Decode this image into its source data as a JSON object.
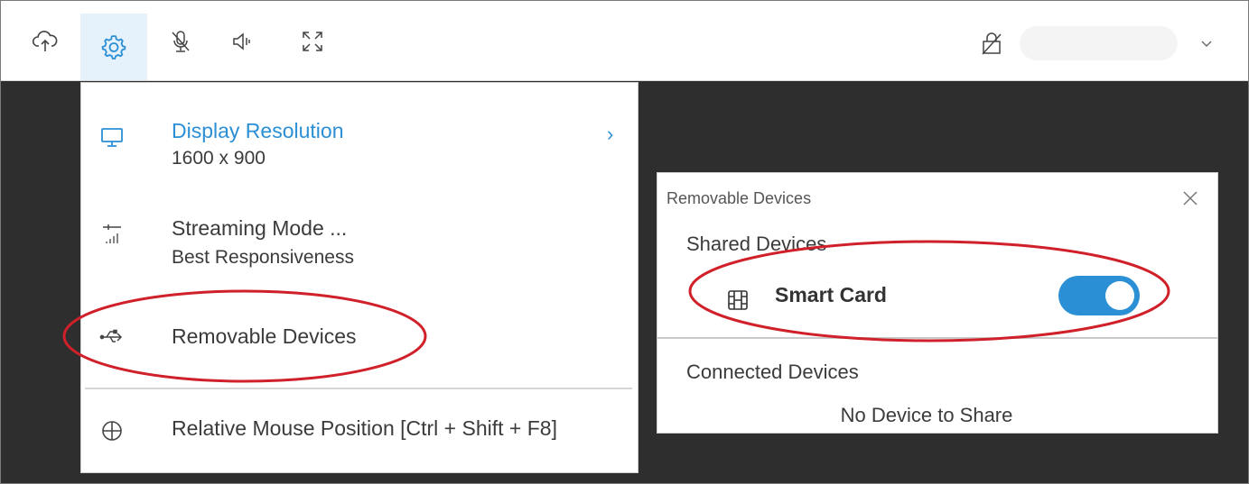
{
  "toolbar": {
    "buttons": [
      {
        "name": "upload-icon",
        "active": false
      },
      {
        "name": "gear-icon",
        "active": true
      },
      {
        "name": "microphone-muted-icon",
        "active": false
      },
      {
        "name": "speaker-icon",
        "active": false
      },
      {
        "name": "fullscreen-icon",
        "active": false
      }
    ],
    "right_icons": [
      "lock-icon",
      "chevron-down-icon"
    ]
  },
  "settings_menu": {
    "items": [
      {
        "icon": "monitor-icon",
        "title": "Display Resolution",
        "subtitle": "1600 x 900",
        "has_submenu": true
      },
      {
        "icon": "streaming-signal-icon",
        "title": "Streaming Mode ...",
        "subtitle": "Best Responsiveness"
      },
      {
        "icon": "usb-icon",
        "title": "Removable Devices"
      },
      {
        "icon": "crosshair-icon",
        "title": "Relative Mouse Position [Ctrl + Shift + F8]"
      }
    ],
    "submenu_arrow": "›"
  },
  "removable_panel": {
    "title": "Removable Devices",
    "shared_heading": "Shared Devices",
    "device": {
      "icon": "smart-card-icon",
      "label": "Smart Card",
      "enabled": true
    },
    "connected_heading": "Connected Devices",
    "empty_message": "No Device to Share"
  },
  "colors": {
    "accent": "#2b8fd6",
    "annotation": "#d0202a",
    "background_dark": "#2e2e2e"
  }
}
